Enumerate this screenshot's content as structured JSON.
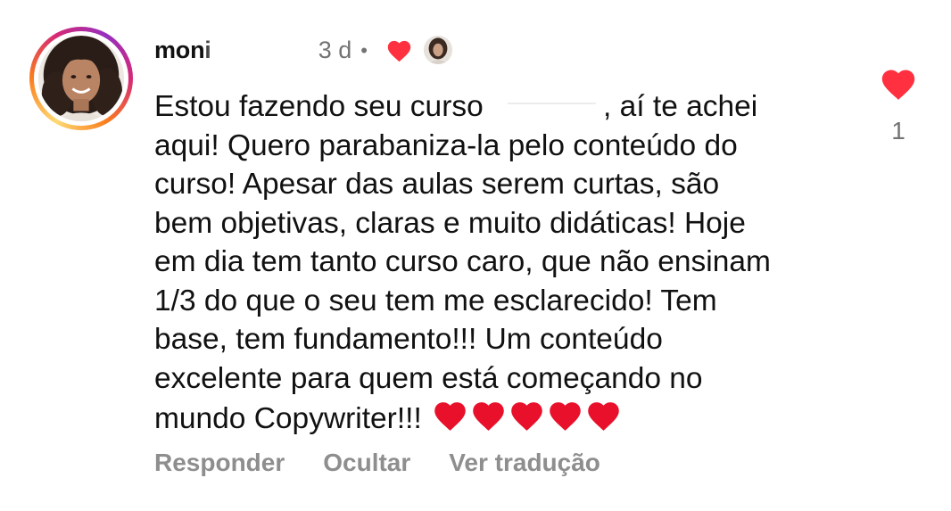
{
  "comment": {
    "username": "moni",
    "time": "3 d",
    "separator": "•",
    "text_part1": "Estou fazendo seu curso ",
    "text_part2": ", aí te achei\naqui! Quero parabaniza-la pelo conteúdo do\ncurso! Apesar das aulas serem curtas, são\nbem objetivas, claras e muito didáticas! Hoje\nem dia tem tanto curso caro, que não ensinam\n1/3 do que o seu tem me esclarecido! Tem\nbase, tem fundamento!!! Um conteúdo\nexcelente para quem está começando no\nmundo Copywriter!!!",
    "emoji_hearts_count": 5,
    "like_count": "1"
  },
  "actions": {
    "reply": "Responder",
    "hide": "Ocultar",
    "translate": "Ver tradução"
  },
  "icons": {
    "heart": "heart-icon",
    "creator_liked": "creator-heart-icon"
  },
  "colors": {
    "heart_red": "#ff3040",
    "muted_text": "#737373",
    "action_text": "#8e8e8e"
  }
}
